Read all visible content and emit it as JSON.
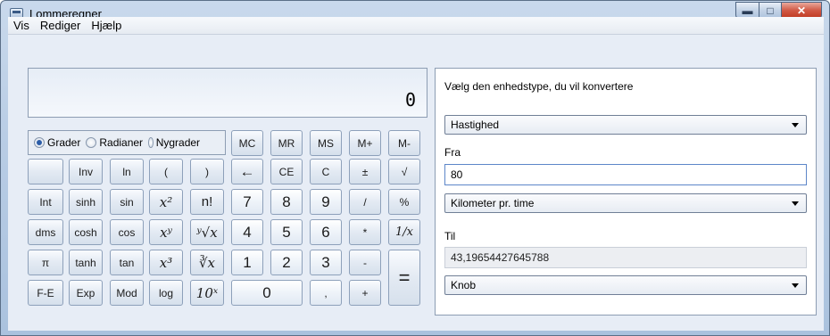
{
  "window": {
    "title": "Lommeregner"
  },
  "menu": [
    "Vis",
    "Rediger",
    "Hjælp"
  ],
  "display": {
    "value": "0"
  },
  "angle_units": {
    "options": [
      "Grader",
      "Radianer",
      "Nygrader"
    ],
    "selected": "Grader"
  },
  "memory_buttons": [
    "MC",
    "MR",
    "MS",
    "M+",
    "M-"
  ],
  "rows": [
    [
      "",
      "Inv",
      "ln",
      "(",
      ")",
      "←",
      "CE",
      "C",
      "±",
      "√"
    ],
    [
      "Int",
      "sinh",
      "sin",
      "x²",
      "n!",
      "7",
      "8",
      "9",
      "/",
      "%"
    ],
    [
      "dms",
      "cosh",
      "cos",
      "xʸ",
      "ʸ√x",
      "4",
      "5",
      "6",
      "*",
      "1/x"
    ],
    [
      "π",
      "tanh",
      "tan",
      "x³",
      "∛x",
      "1",
      "2",
      "3",
      "-",
      "="
    ],
    [
      "F-E",
      "Exp",
      "Mod",
      "log",
      "10ˣ",
      "0",
      ",",
      "+"
    ]
  ],
  "converter": {
    "heading": "Vælg den enhedstype, du vil konvertere",
    "unit_type": "Hastighed",
    "from_label": "Fra",
    "from_value": "80",
    "from_unit": "Kilometer pr. time",
    "to_label": "Til",
    "to_value": "43,19654427645788",
    "to_unit": "Knob"
  },
  "icons": [
    "app-icon",
    "minimize-icon",
    "maximize-icon",
    "close-icon",
    "dropdown-arrow-icon"
  ]
}
